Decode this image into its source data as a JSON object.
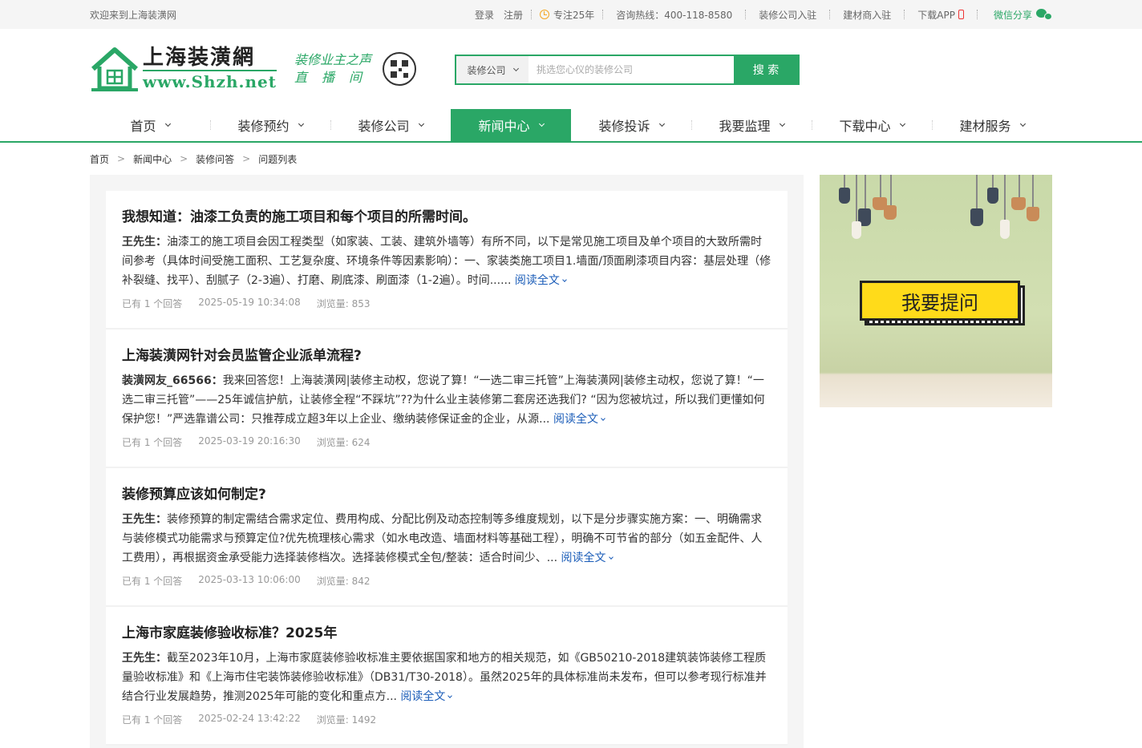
{
  "topbar": {
    "welcome": "欢迎来到上海装潢网",
    "login": "登录",
    "register": "注册",
    "years": "专注25年",
    "hotline": "咨询热线：400-118-8580",
    "company_join": "装修公司入驻",
    "material_join": "建材商入驻",
    "download_app": "下载APP",
    "wechat_share": "微信分享"
  },
  "header": {
    "logo_cn": "上海装潢網",
    "logo_en": "www.Shzh.net",
    "slogan_line1": "装修业主之声",
    "slogan_line2": "直播间"
  },
  "search": {
    "category": "装修公司",
    "placeholder": "挑选您心仪的装修公司",
    "button": "搜 索"
  },
  "nav": {
    "items": [
      {
        "label": "首页"
      },
      {
        "label": "装修预约"
      },
      {
        "label": "装修公司"
      },
      {
        "label": "新闻中心",
        "active": true
      },
      {
        "label": "装修投诉"
      },
      {
        "label": "我要监理"
      },
      {
        "label": "下载中心"
      },
      {
        "label": "建材服务"
      }
    ]
  },
  "breadcrumb": [
    "首页",
    "新闻中心",
    "装修问答",
    "问题列表"
  ],
  "questions": [
    {
      "title": "我想知道：油漆工负责的施工项目和每个项目的所需时间。",
      "author": "王先生：",
      "excerpt": "油漆工的施工项目会因工程类型（如家装、工装、建筑外墙等）有所不同，以下是常见施工项目及单个项目的大致所需时间参考（具体时间受施工面积、工艺复杂度、环境条件等因素影响）：一、家装类施工项目1.墙面/顶面刷漆项目内容：基层处理（修补裂缝、找平）、刮腻子（2-3遍）、打磨、刷底漆、刷面漆（1-2遍）。时间......",
      "more": "阅读全文",
      "answers": "已有 1 个回答",
      "time": "2025-05-19 10:34:08",
      "views": "浏览量: 853"
    },
    {
      "title": "上海装潢网针对会员监管企业派单流程?",
      "author": "装潢网友_66566：",
      "excerpt": "我来回答您！上海装潢网|装修主动权，您说了算！“一选二审三托管”上海装潢网|装修主动权，您说了算！“一选二审三托管”——25年诚信护航，让装修全程“不踩坑”??为什么业主装修第二套房还选我们? “因为您被坑过，所以我们更懂如何保护您！”严选靠谱公司：只推荐成立超3年以上企业、缴纳装修保证金的企业，从源...",
      "more": "阅读全文",
      "answers": "已有 1 个回答",
      "time": "2025-03-19 20:16:30",
      "views": "浏览量: 624"
    },
    {
      "title": "装修预算应该如何制定?",
      "author": "王先生：",
      "excerpt": "装修预算的制定需结合需求定位、费用构成、分配比例及动态控制等多维度规划，以下是分步骤实施方案：一、明确需求与装修模式功能需求与预算定位?优先梳理核心需求（如水电改造、墙面材料等基础工程），明确不可节省的部分（如五金配件、人工费用），再根据资金承受能力选择装修档次。选择装修模式全包/整装：适合时间少、...",
      "more": "阅读全文",
      "answers": "已有 1 个回答",
      "time": "2025-03-13 10:06:00",
      "views": "浏览量: 842"
    },
    {
      "title": "上海市家庭装修验收标准？2025年",
      "author": "王先生：",
      "excerpt": "截至2023年10月，上海市家庭装修验收标准主要依据国家和地方的相关规范，如《GB50210-2018建筑装饰装修工程质量验收标准》和《上海市住宅装饰装修验收标准》（DB31/T30-2018）。虽然2025年的具体标准尚未发布，但可以参考现行标准并结合行业发展趋势，推测2025年可能的变化和重点方...",
      "more": "阅读全文",
      "answers": "已有 1 个回答",
      "time": "2025-02-24 13:42:22",
      "views": "浏览量: 1492"
    }
  ],
  "ad": {
    "ask_label": "我要提问"
  },
  "colors": {
    "brand_green": "#2aa766",
    "link_blue": "#1a5cb8",
    "ask_yellow": "#ffdb1a"
  }
}
